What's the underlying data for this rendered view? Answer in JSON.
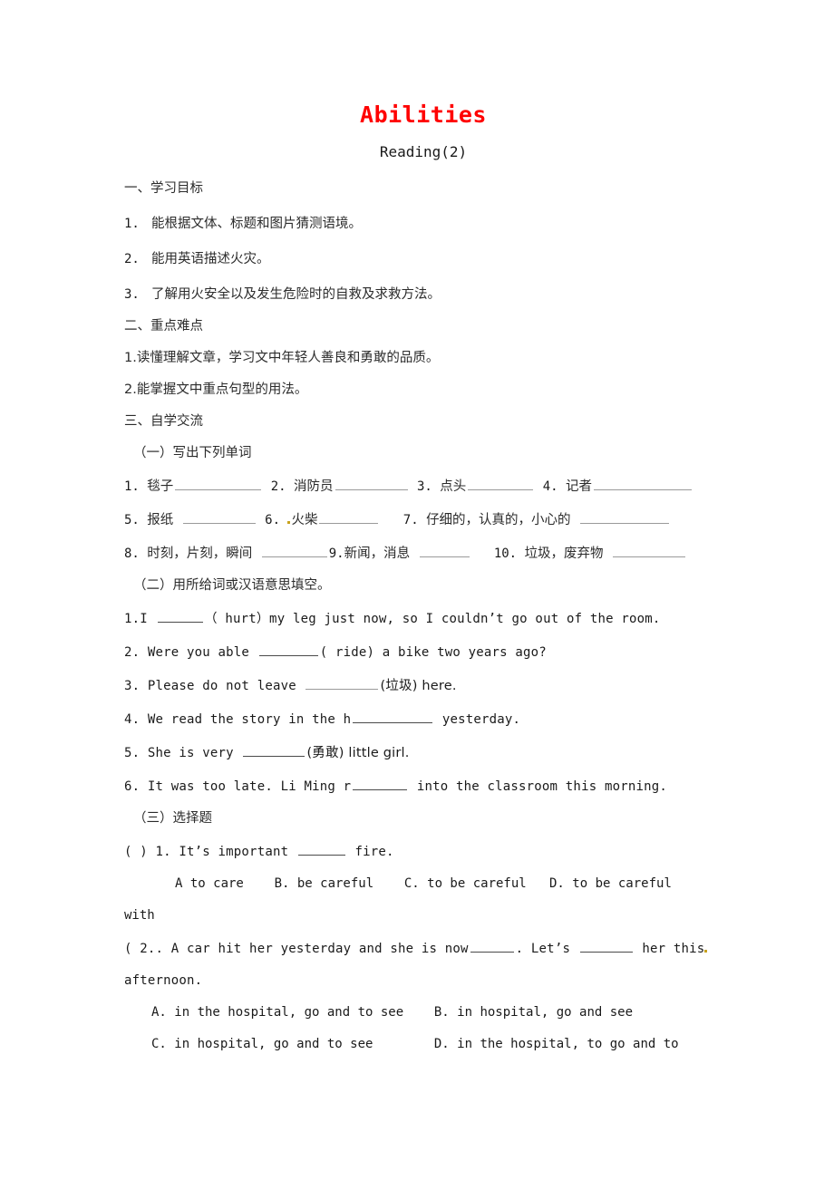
{
  "document": {
    "title": "Abilities",
    "subtitle": "Reading(2)",
    "title_color": "#ff0000"
  },
  "sections": {
    "objectives": {
      "heading": "一、学习目标",
      "items": [
        {
          "index": "1.",
          "text": "能根据文体、标题和图片猜测语境。"
        },
        {
          "index": "2.",
          "text": "能用英语描述火灾。"
        },
        {
          "index": "3.",
          "text": "了解用火安全以及发生危险时的自救及求救方法。"
        }
      ]
    },
    "key_points": {
      "heading": "二、重点难点",
      "items": [
        "1.读懂理解文章，学习文中年轻人善良和勇敢的品质。",
        "2.能掌握文中重点句型的用法。"
      ]
    },
    "self_study": {
      "heading": "三、自学交流",
      "part_one": {
        "heading": "（一）写出下列单词",
        "rows": [
          [
            {
              "index": "1.",
              "word": "毯子",
              "blank": 95
            },
            {
              "index": "2.",
              "word": "消防员",
              "blank": 80
            },
            {
              "index": "3.",
              "word": "点头",
              "blank": 72
            },
            {
              "index": "4.",
              "word": "记者",
              "blank": 108
            }
          ],
          [
            {
              "index": "5.",
              "word": "报纸",
              "blank": 80,
              "gap": 10
            },
            {
              "index": "6.",
              "word": "火柴",
              "blank": 65,
              "mark": true
            },
            {
              "index": "7.",
              "word": "仔细的，认真的，小心的",
              "blank": 98,
              "gap": 8
            }
          ],
          [
            {
              "index": "8.",
              "word": "时刻，片刻，瞬间",
              "blank": 72
            },
            {
              "index": "9.",
              "word": "新闻，消息",
              "blank": 55,
              "gap": 8,
              "tight": true
            },
            {
              "index": "10.",
              "word": "垃圾，废弃物",
              "blank": 80,
              "gap": 8
            }
          ]
        ]
      },
      "part_two": {
        "heading": "（二）用所给词或汉语意思填空。",
        "questions": [
          {
            "prefix": "1.I ",
            "blank": 50,
            "suffix": "（ hurt）my leg just now, so I couldn’t go out of the room."
          },
          {
            "prefix": "2. Were you able ",
            "blank": 65,
            "suffix": "( ride) a bike two years ago?"
          },
          {
            "prefix": "3. Please do not leave ",
            "blank": 80,
            "suffix": "(垃圾) here.",
            "soft": true
          },
          {
            "prefix": "4. We read the story in the h",
            "blank": 88,
            "suffix": " yesterday."
          },
          {
            "prefix": "5. She is very ",
            "blank": 68,
            "suffix": "(勇敢) little girl."
          },
          {
            "prefix": "6. It was too late.  Li Ming  r",
            "blank": 60,
            "suffix": " into the classroom this morning."
          }
        ]
      },
      "part_three": {
        "heading": "（三）选择题",
        "questions": [
          {
            "stem_prefix": "(     ) 1. It’s important ",
            "stem_blank": 52,
            "stem_suffix": " fire.",
            "options_line": "A to care    B. be careful    C. to be careful   D. to be careful",
            "options_overflow": "with"
          },
          {
            "stem_prefix": "(     2.. A car hit her yesterday and she is now",
            "stem_blank": 48,
            "stem_middle": ". Let’s  ",
            "stem_blank2": 58,
            "stem_suffix": " her this",
            "stem_overflow": "afternoon.",
            "option_rows": [
              {
                "left": "A. in the hospital, go and to see",
                "right": "B. in hospital, go and see"
              },
              {
                "left": "C. in hospital, go and to see",
                "right": "D. in the hospital, to go and to"
              }
            ]
          }
        ]
      }
    }
  }
}
